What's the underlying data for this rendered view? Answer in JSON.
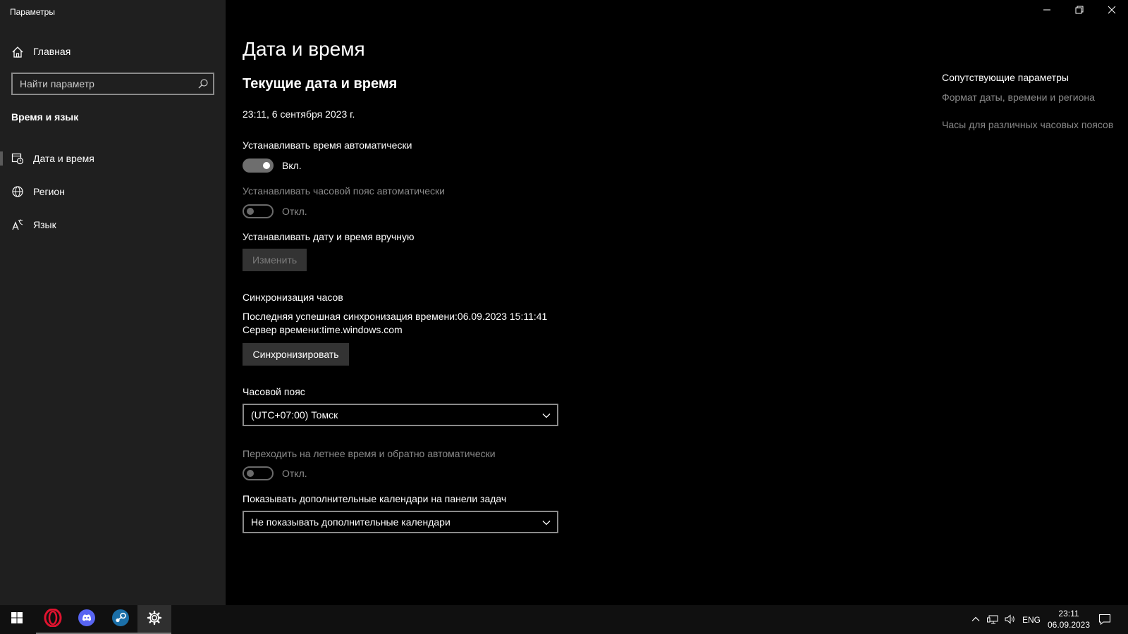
{
  "window": {
    "title": "Параметры"
  },
  "sidebar": {
    "home_label": "Главная",
    "search_placeholder": "Найти параметр",
    "section_title": "Время и язык",
    "items": [
      {
        "label": "Дата и время",
        "icon": "calendar-clock-icon",
        "active": true
      },
      {
        "label": "Регион",
        "icon": "globe-icon",
        "active": false
      },
      {
        "label": "Язык",
        "icon": "language-icon",
        "active": false
      }
    ]
  },
  "main": {
    "page_title": "Дата и время",
    "current_title": "Текущие дата и время",
    "current_datetime": "23:11, 6 сентября 2023 г.",
    "auto_time": {
      "label": "Устанавливать время автоматически",
      "state": "Вкл.",
      "on": true
    },
    "auto_timezone": {
      "label": "Устанавливать часовой пояс автоматически",
      "state": "Откл.",
      "on": false
    },
    "manual": {
      "label": "Устанавливать дату и время вручную",
      "button": "Изменить"
    },
    "sync": {
      "title": "Синхронизация часов",
      "last_sync": "Последняя успешная синхронизация времени:06.09.2023 15:11:41",
      "server": "Сервер времени:time.windows.com",
      "button": "Синхронизировать"
    },
    "timezone": {
      "label": "Часовой пояс",
      "value": "(UTC+07:00) Томск"
    },
    "dst": {
      "label": "Переходить на летнее время и обратно автоматически",
      "state": "Откл.",
      "on": false
    },
    "calendars": {
      "label": "Показывать дополнительные календари на панели задач",
      "value": "Не показывать дополнительные календари"
    }
  },
  "related": {
    "title": "Сопутствующие параметры",
    "links": [
      "Формат даты, времени и региона",
      "Часы для различных часовых поясов"
    ]
  },
  "taskbar": {
    "apps": [
      "start-icon",
      "opera-icon",
      "discord-icon",
      "steam-icon",
      "settings-icon"
    ],
    "language": "ENG",
    "time": "23:11",
    "date": "06.09.2023"
  },
  "colors": {
    "sidebar_bg": "#1f1f1f",
    "main_bg": "#000000",
    "taskbar_bg": "#101010",
    "dim_text": "#8b8b8b"
  }
}
